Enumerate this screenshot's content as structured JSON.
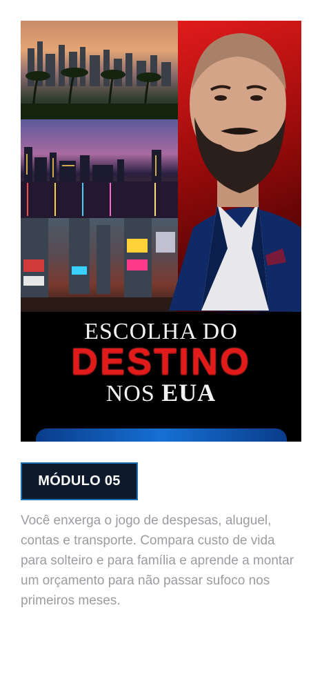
{
  "cover": {
    "title_line1": "ESCOLHA DO",
    "title_line2": "DESTINO",
    "title_line3_a": "NOS ",
    "title_line3_b": "EUA"
  },
  "module": {
    "badge": "MÓDULO 05",
    "description": "Você enxerga o jogo de despesas, aluguel, contas e transporte. Compara custo de vida para solteiro e para família e aprende a montar um orçamento para não passar sufoco nos primeiros meses."
  },
  "colors": {
    "accent_red": "#e21a1a",
    "badge_bg": "#0e1a2b",
    "badge_border": "#1c6fb5",
    "description_text": "#9a9ca0"
  }
}
